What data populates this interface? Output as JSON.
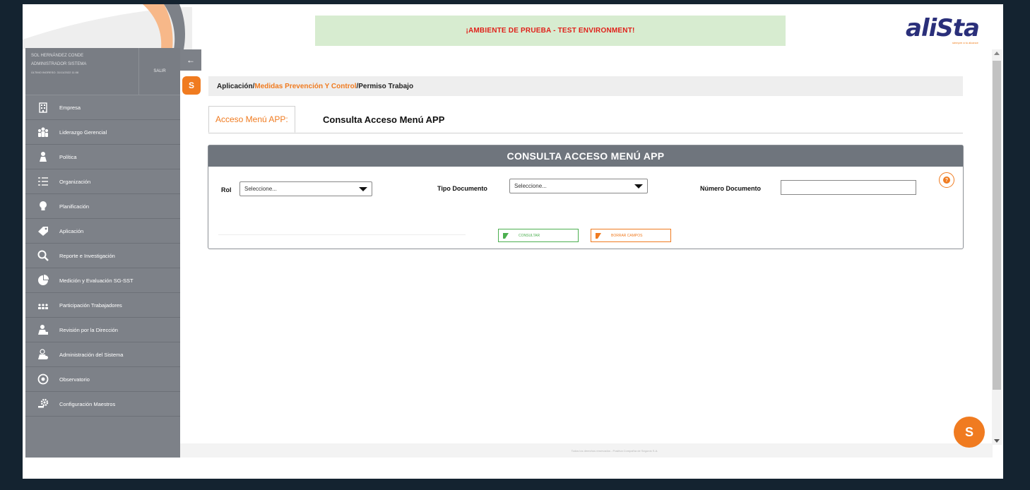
{
  "header": {
    "environment_banner": "¡AMBIENTE DE PRUEBA - TEST ENVIRONMENT!",
    "logo_text": "aliSta",
    "logo_tagline": "siempre a tu alcance"
  },
  "user": {
    "name": "SOL HERNÁNDEZ CONDE",
    "role": "ADMINISTRADOR SISTEMA",
    "last_login": "ÚLTIMO INGRESO: 31/11/2022 11:08",
    "logout_label": "SALIR"
  },
  "sidebar": {
    "items": [
      {
        "label": "Empresa",
        "icon": "building-icon"
      },
      {
        "label": "Liderazgo Gerencial",
        "icon": "leadership-icon"
      },
      {
        "label": "Política",
        "icon": "policy-icon"
      },
      {
        "label": "Organización",
        "icon": "list-icon"
      },
      {
        "label": "Planificación",
        "icon": "lightbulb-icon"
      },
      {
        "label": "Aplicación",
        "icon": "tag-icon"
      },
      {
        "label": "Reporte e Investigación",
        "icon": "magnifier-icon"
      },
      {
        "label": "Medición y Evaluación SG-SST",
        "icon": "pie-chart-icon"
      },
      {
        "label": "Participación Trabajadores",
        "icon": "people-icon"
      },
      {
        "label": "Revisión por la Dirección",
        "icon": "reviewer-icon"
      },
      {
        "label": "Administración del Sistema",
        "icon": "admin-user-icon"
      },
      {
        "label": "Observatorio",
        "icon": "observatory-icon"
      },
      {
        "label": "Configuración Maestros",
        "icon": "settings-icon"
      }
    ]
  },
  "breadcrumb": {
    "root": "Aplicación",
    "sep": "/",
    "middle": "Medidas Prevención Y Control",
    "current": "Permiso Trabajo"
  },
  "tabs": {
    "active": "Acceso Menú APP:",
    "title": "Consulta Acceso Menú APP"
  },
  "panel": {
    "title": "CONSULTA ACCESO MENÚ APP",
    "rol_label": "Rol",
    "rol_value": "Seleccione...",
    "tipo_doc_label": "Tipo Documento",
    "tipo_doc_value": "Seleccione...",
    "num_doc_label": "Número Documento",
    "num_doc_value": "",
    "consultar_label": "CONSULTAR",
    "borrar_label": "BORRAR CAMPOS",
    "help_glyph": "?"
  },
  "footer": {
    "text": "Todos los derechos reservados - Positiva Compañía de Seguros S.A."
  },
  "colors": {
    "accent": "#f07b20",
    "sidebar": "#7d8188",
    "panel_header": "#6f757d",
    "banner_bg": "#d7ecd0",
    "banner_text": "#e0201a",
    "success": "#4caf50"
  }
}
